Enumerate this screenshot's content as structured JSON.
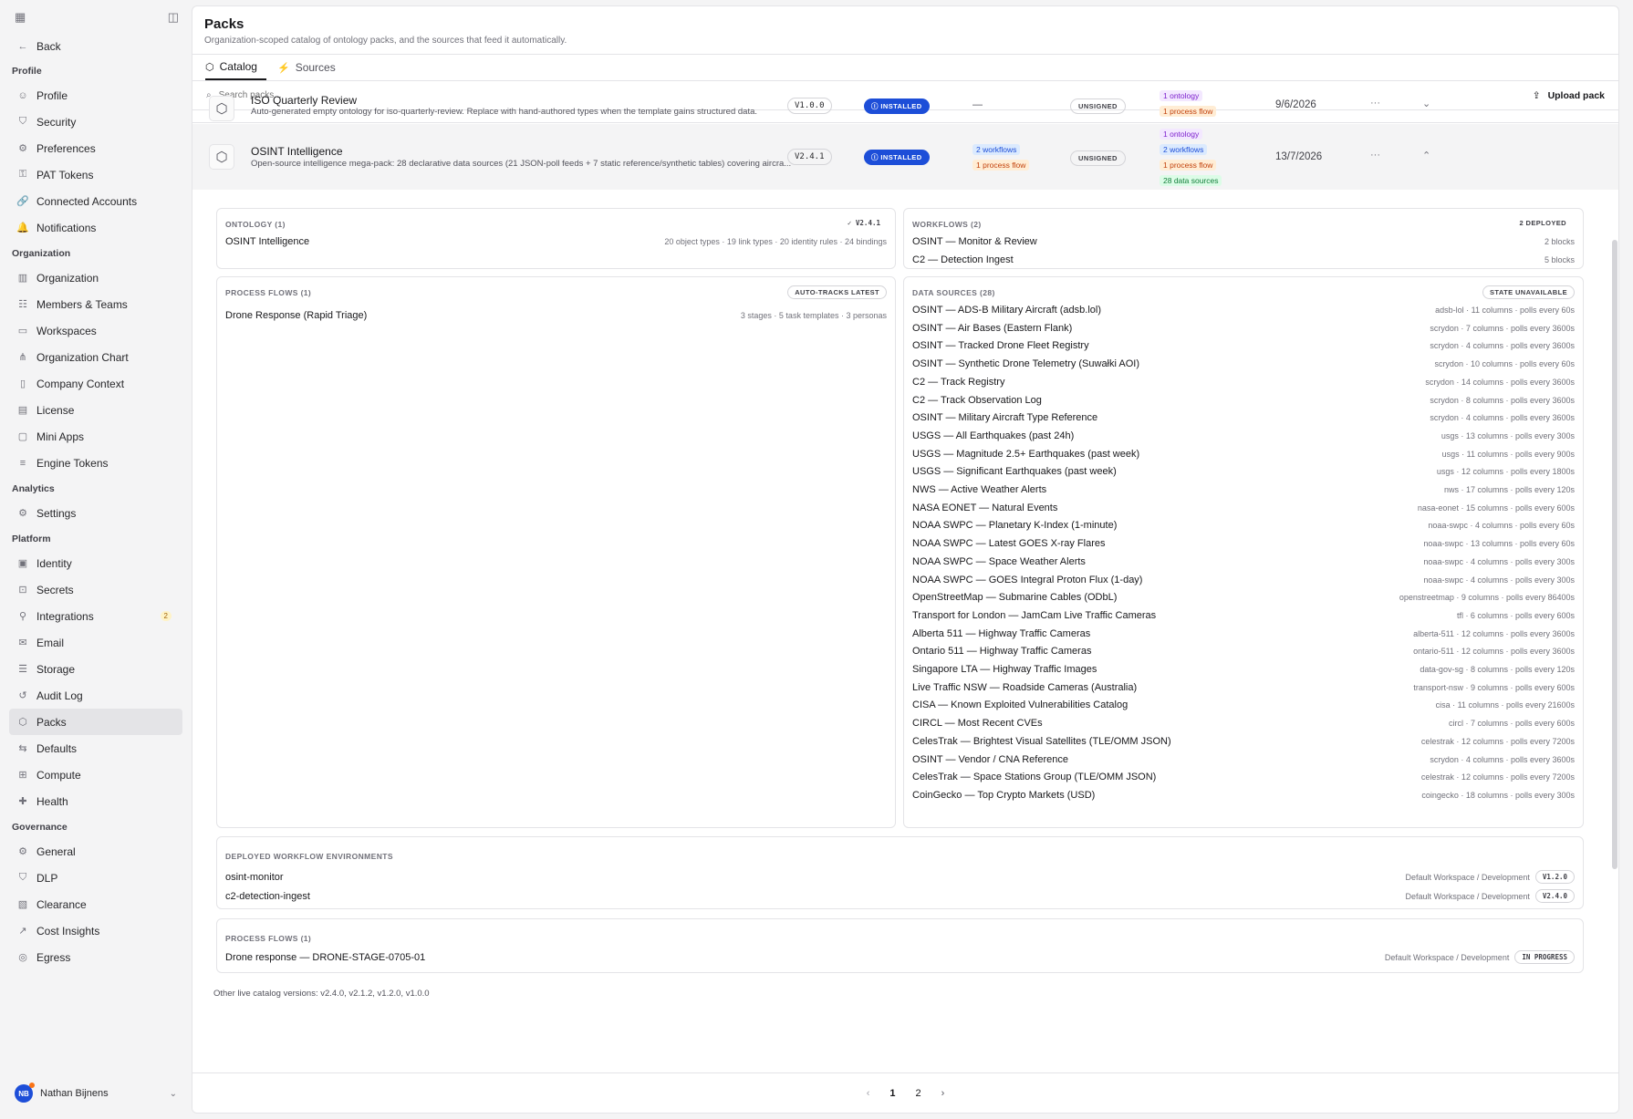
{
  "sidebar": {
    "back": "Back",
    "sections": [
      {
        "title": "Profile",
        "items": [
          {
            "label": "Profile",
            "icon": "user-icon"
          },
          {
            "label": "Security",
            "icon": "shield-icon"
          },
          {
            "label": "Preferences",
            "icon": "gear-icon"
          },
          {
            "label": "PAT Tokens",
            "icon": "key-icon"
          },
          {
            "label": "Connected Accounts",
            "icon": "link-icon"
          },
          {
            "label": "Notifications",
            "icon": "bell-icon"
          }
        ]
      },
      {
        "title": "Organization",
        "items": [
          {
            "label": "Organization",
            "icon": "building-icon"
          },
          {
            "label": "Members & Teams",
            "icon": "users-icon"
          },
          {
            "label": "Workspaces",
            "icon": "monitor-icon"
          },
          {
            "label": "Organization Chart",
            "icon": "org-chart-icon"
          },
          {
            "label": "Company Context",
            "icon": "book-icon"
          },
          {
            "label": "License",
            "icon": "document-icon"
          },
          {
            "label": "Mini Apps",
            "icon": "window-icon"
          },
          {
            "label": "Engine Tokens",
            "icon": "database-icon"
          }
        ]
      },
      {
        "title": "Analytics",
        "items": [
          {
            "label": "Settings",
            "icon": "gear-icon"
          }
        ]
      },
      {
        "title": "Platform",
        "items": [
          {
            "label": "Identity",
            "icon": "id-card-icon"
          },
          {
            "label": "Secrets",
            "icon": "lock-icon"
          },
          {
            "label": "Integrations",
            "icon": "plug-icon",
            "badge": "2"
          },
          {
            "label": "Email",
            "icon": "mail-icon"
          },
          {
            "label": "Storage",
            "icon": "storage-icon"
          },
          {
            "label": "Audit Log",
            "icon": "history-icon"
          },
          {
            "label": "Packs",
            "icon": "package-icon",
            "active": true
          },
          {
            "label": "Defaults",
            "icon": "sliders-icon"
          },
          {
            "label": "Compute",
            "icon": "cpu-icon"
          },
          {
            "label": "Health",
            "icon": "heart-icon"
          }
        ]
      },
      {
        "title": "Governance",
        "items": [
          {
            "label": "General",
            "icon": "gear-icon"
          },
          {
            "label": "DLP",
            "icon": "shield-icon"
          },
          {
            "label": "Clearance",
            "icon": "badge-icon"
          },
          {
            "label": "Cost Insights",
            "icon": "chart-icon"
          },
          {
            "label": "Egress",
            "icon": "globe-icon"
          }
        ]
      }
    ],
    "user": {
      "initials": "NB",
      "name": "Nathan Bijnens"
    }
  },
  "header": {
    "title": "Packs",
    "subtitle": "Organization-scoped catalog of ontology packs, and the sources that feed it automatically."
  },
  "tabs": [
    {
      "label": "Catalog",
      "active": true
    },
    {
      "label": "Sources"
    }
  ],
  "search": {
    "placeholder": "Search packs..."
  },
  "upload_label": "Upload pack",
  "packs": [
    {
      "name": "ISO Quarterly Review",
      "desc": "Auto-generated empty ontology for iso-quarterly-review. Replace with hand-authored types when the template gains structured data.",
      "version": "V1.0.0",
      "status": "INSTALLED",
      "workflows": "—",
      "signature": "UNSIGNED",
      "chips": [
        "1 ontology",
        "1 process flow"
      ],
      "date": "9/6/2026"
    },
    {
      "name": "OSINT Intelligence",
      "desc": "Open-source intelligence mega-pack: 28 declarative data sources (21 JSON-poll feeds + 7 static reference/synthetic tables) covering aircra...",
      "version": "V2.4.1",
      "status": "INSTALLED",
      "workflow_chips": [
        "2 workflows",
        "1 process flow"
      ],
      "signature": "UNSIGNED",
      "chips": [
        "1 ontology",
        "2 workflows",
        "1 process flow",
        "28 data sources"
      ],
      "date": "13/7/2026"
    }
  ],
  "detail": {
    "ontology": {
      "title": "ONTOLOGY (1)",
      "version": "V2.4.1",
      "name": "OSINT Intelligence",
      "meta": "20 object types · 19 link types · 20 identity rules · 24 bindings"
    },
    "workflows": {
      "title": "WORKFLOWS (2)",
      "pill": "2 DEPLOYED",
      "items": [
        {
          "name": "OSINT — Monitor & Review",
          "meta": "2 blocks"
        },
        {
          "name": "C2 — Detection Ingest",
          "meta": "5 blocks"
        }
      ]
    },
    "process_flows": {
      "title": "PROCESS FLOWS (1)",
      "pill": "AUTO-TRACKS LATEST",
      "name": "Drone Response (Rapid Triage)",
      "meta": "3 stages · 5 task templates · 3 personas"
    },
    "data_sources": {
      "title": "DATA SOURCES (28)",
      "pill": "STATE UNAVAILABLE",
      "items": [
        {
          "name": "OSINT — ADS-B Military Aircraft (adsb.lol)",
          "meta": "adsb-lol · 11 columns · polls every 60s"
        },
        {
          "name": "OSINT — Air Bases (Eastern Flank)",
          "meta": "scrydon · 7 columns · polls every 3600s"
        },
        {
          "name": "OSINT — Tracked Drone Fleet Registry",
          "meta": "scrydon · 4 columns · polls every 3600s"
        },
        {
          "name": "OSINT — Synthetic Drone Telemetry (Suwałki AOI)",
          "meta": "scrydon · 10 columns · polls every 60s"
        },
        {
          "name": "C2 — Track Registry",
          "meta": "scrydon · 14 columns · polls every 3600s"
        },
        {
          "name": "C2 — Track Observation Log",
          "meta": "scrydon · 8 columns · polls every 3600s"
        },
        {
          "name": "OSINT — Military Aircraft Type Reference",
          "meta": "scrydon · 4 columns · polls every 3600s"
        },
        {
          "name": "USGS — All Earthquakes (past 24h)",
          "meta": "usgs · 13 columns · polls every 300s"
        },
        {
          "name": "USGS — Magnitude 2.5+ Earthquakes (past week)",
          "meta": "usgs · 11 columns · polls every 900s"
        },
        {
          "name": "USGS — Significant Earthquakes (past week)",
          "meta": "usgs · 12 columns · polls every 1800s"
        },
        {
          "name": "NWS — Active Weather Alerts",
          "meta": "nws · 17 columns · polls every 120s"
        },
        {
          "name": "NASA EONET — Natural Events",
          "meta": "nasa-eonet · 15 columns · polls every 600s"
        },
        {
          "name": "NOAA SWPC — Planetary K-Index (1-minute)",
          "meta": "noaa-swpc · 4 columns · polls every 60s"
        },
        {
          "name": "NOAA SWPC — Latest GOES X-ray Flares",
          "meta": "noaa-swpc · 13 columns · polls every 60s"
        },
        {
          "name": "NOAA SWPC — Space Weather Alerts",
          "meta": "noaa-swpc · 4 columns · polls every 300s"
        },
        {
          "name": "NOAA SWPC — GOES Integral Proton Flux (1-day)",
          "meta": "noaa-swpc · 4 columns · polls every 300s"
        },
        {
          "name": "OpenStreetMap — Submarine Cables (ODbL)",
          "meta": "openstreetmap · 9 columns · polls every 86400s"
        },
        {
          "name": "Transport for London — JamCam Live Traffic Cameras",
          "meta": "tfl · 6 columns · polls every 600s"
        },
        {
          "name": "Alberta 511 — Highway Traffic Cameras",
          "meta": "alberta-511 · 12 columns · polls every 3600s"
        },
        {
          "name": "Ontario 511 — Highway Traffic Cameras",
          "meta": "ontario-511 · 12 columns · polls every 3600s"
        },
        {
          "name": "Singapore LTA — Highway Traffic Images",
          "meta": "data-gov-sg · 8 columns · polls every 120s"
        },
        {
          "name": "Live Traffic NSW — Roadside Cameras (Australia)",
          "meta": "transport-nsw · 9 columns · polls every 600s"
        },
        {
          "name": "CISA — Known Exploited Vulnerabilities Catalog",
          "meta": "cisa · 11 columns · polls every 21600s"
        },
        {
          "name": "CIRCL — Most Recent CVEs",
          "meta": "circl · 7 columns · polls every 600s"
        },
        {
          "name": "CelesTrak — Brightest Visual Satellites (TLE/OMM JSON)",
          "meta": "celestrak · 12 columns · polls every 7200s"
        },
        {
          "name": "OSINT — Vendor / CNA Reference",
          "meta": "scrydon · 4 columns · polls every 3600s"
        },
        {
          "name": "CelesTrak — Space Stations Group (TLE/OMM JSON)",
          "meta": "celestrak · 12 columns · polls every 7200s"
        },
        {
          "name": "CoinGecko — Top Crypto Markets (USD)",
          "meta": "coingecko · 18 columns · polls every 300s"
        }
      ]
    },
    "deployed_envs": {
      "title": "DEPLOYED WORKFLOW ENVIRONMENTS",
      "items": [
        {
          "name": "osint-monitor",
          "env": "Default Workspace / Development",
          "version": "V1.2.0"
        },
        {
          "name": "c2-detection-ingest",
          "env": "Default Workspace / Development",
          "version": "V2.4.0"
        }
      ]
    },
    "process_instances": {
      "title": "PROCESS FLOWS (1)",
      "name": "Drone response — DRONE-STAGE-0705-01",
      "env": "Default Workspace / Development",
      "status": "IN PROGRESS"
    },
    "other_versions": "Other live catalog versions: v2.4.0, v2.1.2, v1.2.0, v1.0.0"
  },
  "pager": {
    "pages": [
      "1",
      "2"
    ]
  }
}
